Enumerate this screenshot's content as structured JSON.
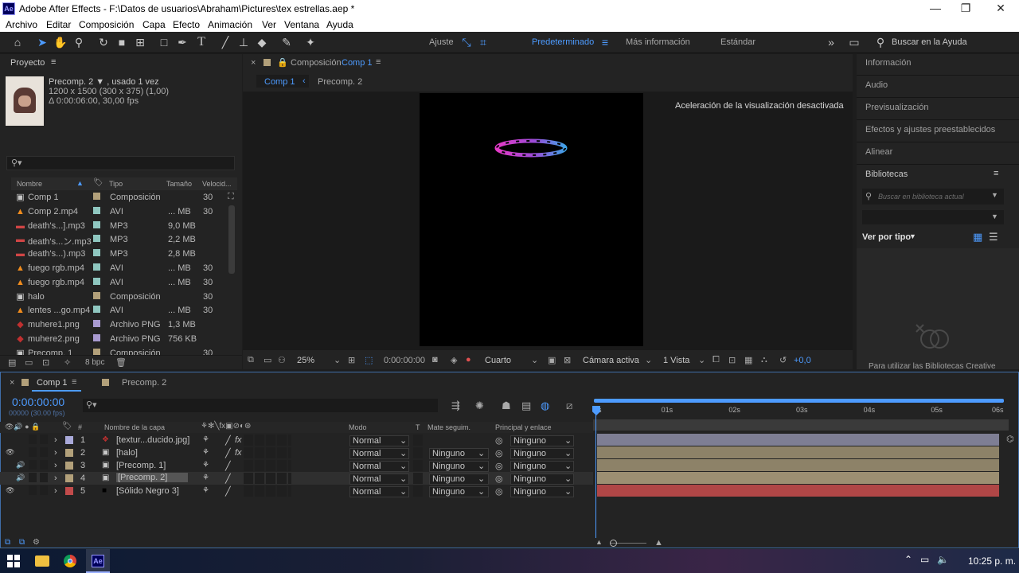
{
  "app": {
    "title": "Adobe After Effects - F:\\Datos de usuarios\\Abraham\\Pictures\\tex estrellas.aep *",
    "logo": "Ae"
  },
  "menu": [
    "Archivo",
    "Editar",
    "Composición",
    "Capa",
    "Efecto",
    "Animación",
    "Ver",
    "Ventana",
    "Ayuda"
  ],
  "toolbar": {
    "ajuste_label": "Ajuste",
    "workspaces": [
      "Predeterminado",
      "Más información",
      "Estándar"
    ],
    "search_placeholder": "Buscar en la Ayuda"
  },
  "project": {
    "panel_title": "Proyecto",
    "selected_name": "Precomp. 2 ▼ , usado 1 vez",
    "selected_dims": "1200 x 1500  (300 x 375) (1,00)",
    "selected_duration": "Δ 0:00:06:00, 30,00 fps",
    "search_placeholder": "",
    "columns": [
      "Nombre",
      "Tipo",
      "Tamaño",
      "Velocid..."
    ],
    "items": [
      {
        "name": "Comp 1",
        "type": "Composición",
        "size": "",
        "fps": "30",
        "color": "#b2a07a",
        "icon": "comp-icon"
      },
      {
        "name": "Comp 2.mp4",
        "type": "AVI",
        "size": "... MB",
        "fps": "30",
        "color": "#8fc7c0",
        "icon": "vlc-icon"
      },
      {
        "name": "death's...].mp3",
        "type": "MP3",
        "size": "9,0 MB",
        "fps": "",
        "color": "#8fc7c0",
        "icon": "audio-icon"
      },
      {
        "name": "death's...ン.mp3",
        "type": "MP3",
        "size": "2,2 MB",
        "fps": "",
        "color": "#8fc7c0",
        "icon": "audio-icon"
      },
      {
        "name": "death's...).mp3",
        "type": "MP3",
        "size": "2,8 MB",
        "fps": "",
        "color": "#8fc7c0",
        "icon": "audio-icon"
      },
      {
        "name": "fuego rgb.mp4",
        "type": "AVI",
        "size": "... MB",
        "fps": "30",
        "color": "#8fc7c0",
        "icon": "vlc-icon"
      },
      {
        "name": "fuego rgb.mp4",
        "type": "AVI",
        "size": "... MB",
        "fps": "30",
        "color": "#8fc7c0",
        "icon": "vlc-icon"
      },
      {
        "name": "halo",
        "type": "Composición",
        "size": "",
        "fps": "30",
        "color": "#b2a07a",
        "icon": "comp-icon"
      },
      {
        "name": "lentes ...go.mp4",
        "type": "AVI",
        "size": "... MB",
        "fps": "30",
        "color": "#8fc7c0",
        "icon": "vlc-icon"
      },
      {
        "name": "muhere1.png",
        "type": "Archivo PNG",
        "size": "1,3 MB",
        "fps": "",
        "color": "#a89ad0",
        "icon": "png-icon"
      },
      {
        "name": "muhere2.png",
        "type": "Archivo PNG",
        "size": "756 KB",
        "fps": "",
        "color": "#a89ad0",
        "icon": "png-icon"
      },
      {
        "name": "Precomp. 1",
        "type": "Composición",
        "size": "",
        "fps": "30",
        "color": "#b2a07a",
        "icon": "comp-icon"
      }
    ],
    "bpc": "8 bpc"
  },
  "composition": {
    "panel_prefix": "Composición",
    "panel_comp": "Comp 1",
    "breadcrumbs": [
      "Comp 1",
      "Precomp. 2"
    ],
    "notice": "Aceleración de la visualización desactivada",
    "zoom": "25%",
    "timecode": "0:00:00:00",
    "resolution": "Cuarto",
    "camera": "Cámara activa",
    "views": "1 Vista",
    "exposure": "+0,0"
  },
  "right_panels": [
    "Información",
    "Audio",
    "Previsualización",
    "Efectos y ajustes preestablecidos",
    "Alinear",
    "Bibliotecas"
  ],
  "libraries": {
    "search_placeholder": "Buscar en biblioteca actual",
    "view_by": "Ver por tipo",
    "cc_message": "Para utilizar las Bibliotecas Creative"
  },
  "timeline": {
    "tabs": [
      "Comp 1",
      "Precomp. 2"
    ],
    "timecode": "0:00:00:00",
    "frames": "00000 (30.00 fps)",
    "columns": {
      "num": "#",
      "name": "Nombre de la capa",
      "mode": "Modo",
      "t": "T",
      "matte": "Mate seguim.",
      "parent": "Principal y enlace"
    },
    "ruler": [
      "0s",
      "01s",
      "02s",
      "03s",
      "04s",
      "05s",
      "06s"
    ],
    "layers": [
      {
        "num": "1",
        "name": "[textur...ducido.jpg]",
        "color": "#a9a9d9",
        "mode": "Normal",
        "matte": "",
        "parent": "Ninguno",
        "fx": true,
        "eye": false,
        "audio": false,
        "bar": "#7e7e94",
        "icon": "image-icon"
      },
      {
        "num": "2",
        "name": "[halo]",
        "color": "#b2a07a",
        "mode": "Normal",
        "matte": "Ninguno",
        "parent": "Ninguno",
        "fx": true,
        "eye": true,
        "audio": false,
        "bar": "#8d8268",
        "icon": "comp-icon"
      },
      {
        "num": "3",
        "name": "[Precomp. 1]",
        "color": "#b2a07a",
        "mode": "Normal",
        "matte": "Ninguno",
        "parent": "Ninguno",
        "fx": false,
        "eye": false,
        "audio": true,
        "bar": "#8d8268",
        "icon": "comp-icon"
      },
      {
        "num": "4",
        "name": "[Precomp. 2]",
        "color": "#b2a07a",
        "mode": "Normal",
        "matte": "Ninguno",
        "parent": "Ninguno",
        "fx": false,
        "eye": false,
        "audio": true,
        "bar": "#9c8f72",
        "icon": "comp-icon",
        "selected": true
      },
      {
        "num": "5",
        "name": "[Sólido Negro 3]",
        "color": "#c24b4b",
        "mode": "Normal",
        "matte": "Ninguno",
        "parent": "Ninguno",
        "fx": false,
        "eye": true,
        "audio": false,
        "bar": "#b04646",
        "icon": "solid-icon"
      }
    ]
  },
  "taskbar": {
    "time": "10:25 p. m."
  }
}
